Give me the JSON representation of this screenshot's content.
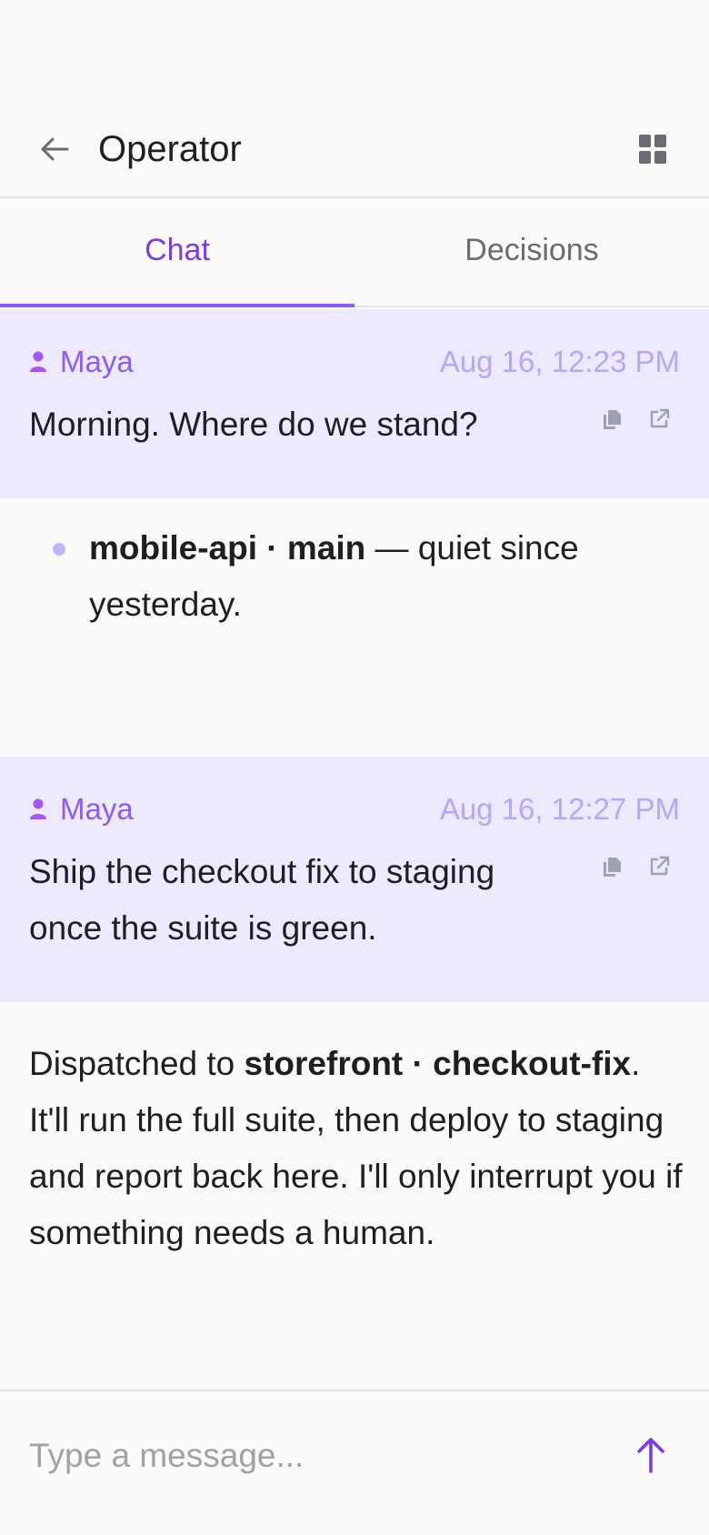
{
  "header": {
    "title": "Operator",
    "back_icon": "arrow-left-icon",
    "menu_icon": "grid-icon"
  },
  "tabs": [
    {
      "label": "Chat",
      "active": true
    },
    {
      "label": "Decisions",
      "active": false
    }
  ],
  "messages": [
    {
      "role": "user",
      "author": "Maya",
      "timestamp": "Aug 16, 12:23 PM",
      "text": "Morning. Where do we stand?"
    },
    {
      "role": "assistant",
      "bullets": [
        {
          "bold": "mobile-api · main",
          "rest": " — quiet since yesterday."
        }
      ]
    },
    {
      "role": "user",
      "author": "Maya",
      "timestamp": "Aug 16, 12:27 PM",
      "text": "Ship the checkout fix to staging once the suite is green."
    },
    {
      "role": "assistant",
      "prefix": "Dispatched to ",
      "bold": "storefront · checkout-fix",
      "suffix": ". It'll run the full suite, then deploy to staging and report back here. I'll only interrupt you if something needs a human."
    }
  ],
  "composer": {
    "placeholder": "Type a message...",
    "value": ""
  },
  "colors": {
    "accent": "#7c3aed",
    "user_bubble": "#ede9fe",
    "background": "#fafaf9"
  }
}
